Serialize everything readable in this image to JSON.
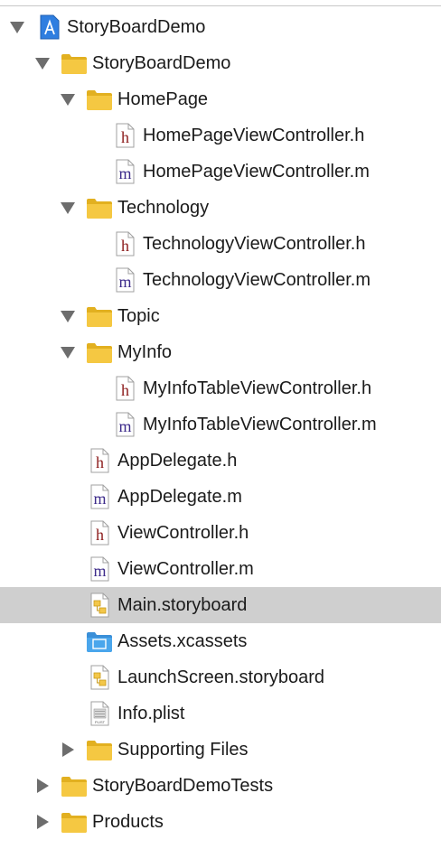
{
  "navigator": {
    "items": [
      {
        "label": "StoryBoardDemo",
        "icon": "project-icon",
        "level": 0,
        "disclosure": "expanded"
      },
      {
        "label": "StoryBoardDemo",
        "icon": "folder-icon",
        "level": 1,
        "disclosure": "expanded"
      },
      {
        "label": "HomePage",
        "icon": "folder-icon",
        "level": 2,
        "disclosure": "expanded"
      },
      {
        "label": "HomePageViewController.h",
        "icon": "header-file-icon",
        "level": 3,
        "disclosure": "none"
      },
      {
        "label": "HomePageViewController.m",
        "icon": "implementation-file-icon",
        "level": 3,
        "disclosure": "none"
      },
      {
        "label": "Technology",
        "icon": "folder-icon",
        "level": 2,
        "disclosure": "expanded"
      },
      {
        "label": "TechnologyViewController.h",
        "icon": "header-file-icon",
        "level": 3,
        "disclosure": "none"
      },
      {
        "label": "TechnologyViewController.m",
        "icon": "implementation-file-icon",
        "level": 3,
        "disclosure": "none"
      },
      {
        "label": "Topic",
        "icon": "folder-icon",
        "level": 2,
        "disclosure": "expanded"
      },
      {
        "label": "MyInfo",
        "icon": "folder-icon",
        "level": 2,
        "disclosure": "expanded"
      },
      {
        "label": "MyInfoTableViewController.h",
        "icon": "header-file-icon",
        "level": 3,
        "disclosure": "none"
      },
      {
        "label": "MyInfoTableViewController.m",
        "icon": "implementation-file-icon",
        "level": 3,
        "disclosure": "none"
      },
      {
        "label": "AppDelegate.h",
        "icon": "header-file-icon",
        "level": 2,
        "disclosure": "none"
      },
      {
        "label": "AppDelegate.m",
        "icon": "implementation-file-icon",
        "level": 2,
        "disclosure": "none"
      },
      {
        "label": "ViewController.h",
        "icon": "header-file-icon",
        "level": 2,
        "disclosure": "none"
      },
      {
        "label": "ViewController.m",
        "icon": "implementation-file-icon",
        "level": 2,
        "disclosure": "none"
      },
      {
        "label": "Main.storyboard",
        "icon": "storyboard-icon",
        "level": 2,
        "disclosure": "none",
        "selected": true
      },
      {
        "label": "Assets.xcassets",
        "icon": "asset-catalog-icon",
        "level": 2,
        "disclosure": "none"
      },
      {
        "label": "LaunchScreen.storyboard",
        "icon": "storyboard-icon",
        "level": 2,
        "disclosure": "none"
      },
      {
        "label": "Info.plist",
        "icon": "plist-icon",
        "level": 2,
        "disclosure": "none"
      },
      {
        "label": "Supporting Files",
        "icon": "folder-icon",
        "level": 2,
        "disclosure": "collapsed"
      },
      {
        "label": "StoryBoardDemoTests",
        "icon": "folder-icon",
        "level": 1,
        "disclosure": "collapsed"
      },
      {
        "label": "Products",
        "icon": "folder-icon",
        "level": 1,
        "disclosure": "collapsed"
      }
    ]
  },
  "icon_glyphs": {
    "header": "h",
    "implementation": "m",
    "plist": "PLIST"
  },
  "colors": {
    "selection": "#cfcfcf",
    "folder": "#f5c842",
    "disclosure": "#6d6d6d",
    "header_glyph": "#8b1a1a",
    "implementation_glyph": "#3c2a8a",
    "project_blue": "#2f7ee0",
    "asset_blue": "#4aa6ec"
  }
}
